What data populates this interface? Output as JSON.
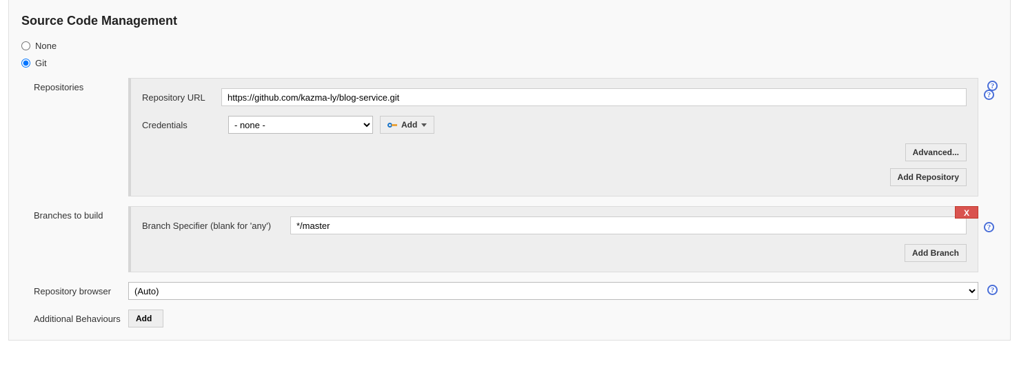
{
  "title": "Source Code Management",
  "scm_options": {
    "none": {
      "label": "None",
      "checked": false
    },
    "git": {
      "label": "Git",
      "checked": true
    }
  },
  "repositories": {
    "section_label": "Repositories",
    "url_label": "Repository URL",
    "url_value": "https://github.com/kazma-ly/blog-service.git",
    "credentials_label": "Credentials",
    "credentials_value": "- none -",
    "add_cred_label": "Add",
    "advanced_label": "Advanced...",
    "add_repo_label": "Add Repository"
  },
  "branches": {
    "section_label": "Branches to build",
    "specifier_label": "Branch Specifier (blank for 'any')",
    "specifier_value": "*/master",
    "add_branch_label": "Add Branch",
    "delete_label": "X"
  },
  "browser": {
    "label": "Repository browser",
    "value": "(Auto)"
  },
  "behaviours": {
    "label": "Additional Behaviours",
    "add_label": "Add"
  },
  "help_glyph": "?"
}
